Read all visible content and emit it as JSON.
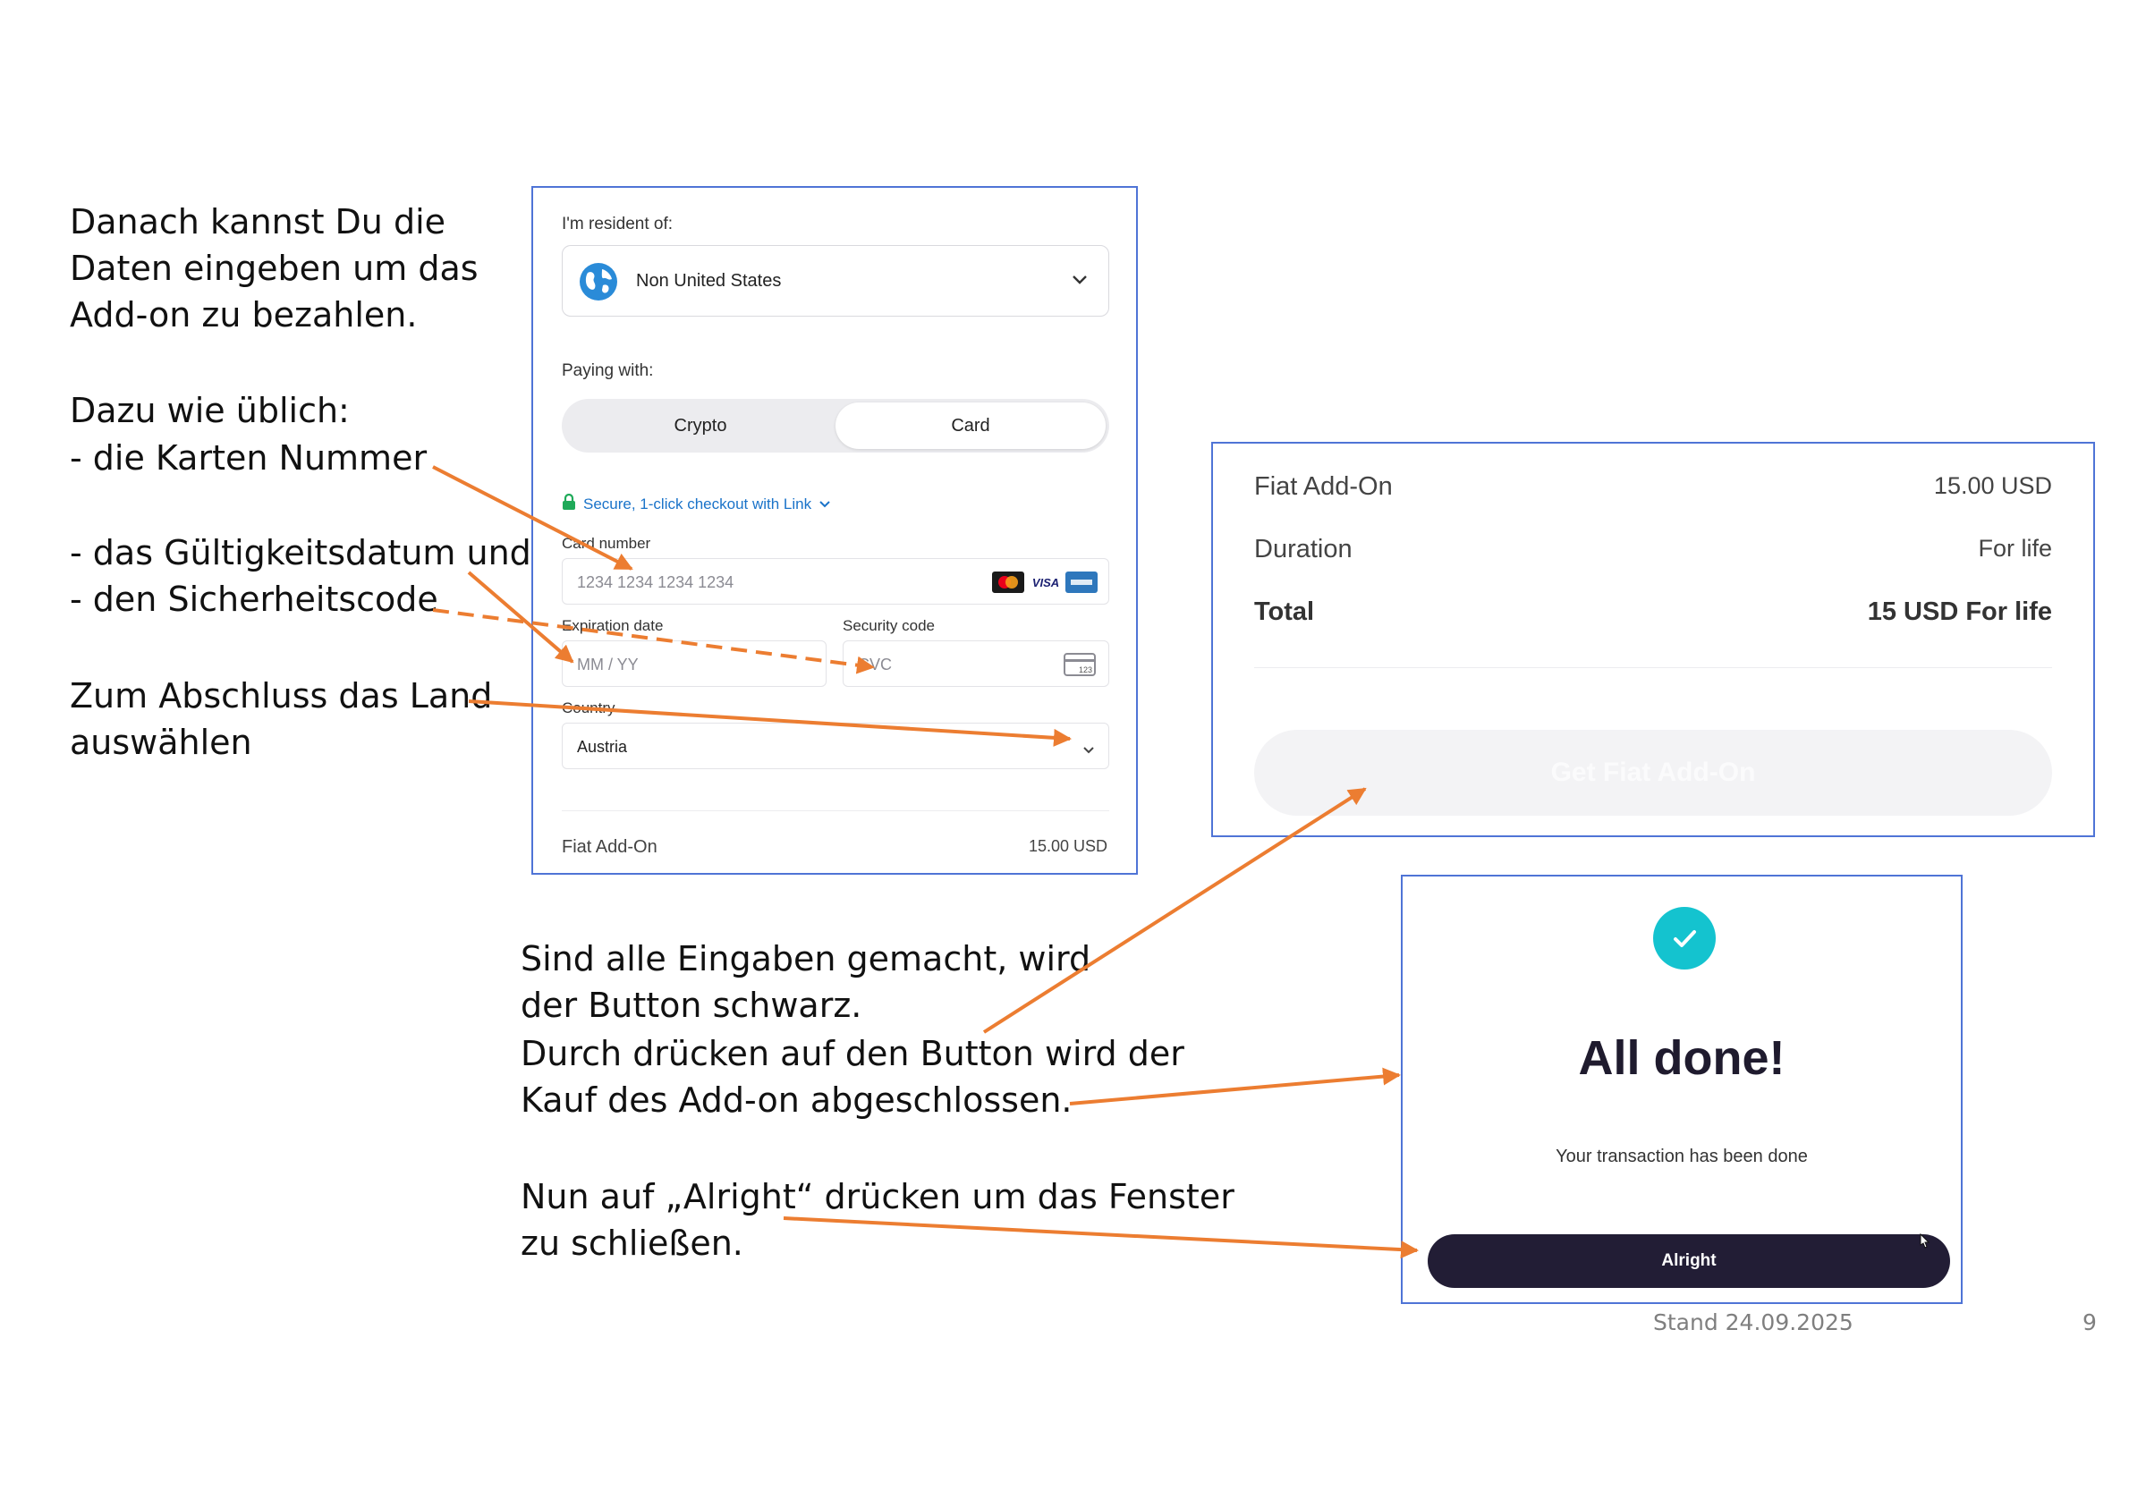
{
  "instructions": {
    "intro": [
      "Danach kannst Du die",
      "Daten eingeben um das",
      "Add-on zu bezahlen."
    ],
    "list_header": "Dazu wie üblich:",
    "card_number": "- die Karten Nummer",
    "expiry": "- das Gültigkeitsdatum und",
    "security": "- den Sicherheitscode",
    "country": [
      "Zum Abschluss das Land",
      "auswählen"
    ],
    "button_note": [
      "Sind alle Eingaben gemacht, wird",
      "der Button schwarz.",
      "Durch drücken auf den Button wird der",
      "Kauf des Add-on abgeschlossen."
    ],
    "alright_note": [
      "Nun auf „Alright“ drücken um das Fenster",
      "zu schließen."
    ]
  },
  "payment_form": {
    "resident_label": "I'm resident of:",
    "resident_value": "Non United States",
    "paying_label": "Paying with:",
    "tabs": [
      "Crypto",
      "Card"
    ],
    "active_tab": "Card",
    "link_text": "Secure, 1-click checkout with Link",
    "card_number_label": "Card number",
    "card_number_placeholder": "1234 1234 1234 1234",
    "card_brands": [
      "VISA"
    ],
    "expiration_label": "Expiration date",
    "expiration_placeholder": "MM / YY",
    "security_label": "Security code",
    "security_placeholder": "CVC",
    "cvc_icon_text": "123",
    "country_label": "Country",
    "country_value": "Austria",
    "summary_item": "Fiat Add-On",
    "summary_price": "15.00 USD"
  },
  "summary_panel": {
    "item_label": "Fiat Add-On",
    "item_value": "15.00 USD",
    "duration_label": "Duration",
    "duration_value": "For life",
    "total_label": "Total",
    "total_value": "15 USD For life",
    "button_label": "Get Fiat Add-On"
  },
  "done_dialog": {
    "title": "All done!",
    "message": "Your transaction has been done",
    "button_label": "Alright"
  },
  "footer": {
    "date": "Stand 24.09.2025",
    "page": "9"
  },
  "colors": {
    "arrow": "#ec7d31",
    "frame": "#4f74d6",
    "dark_button": "#221d35",
    "check": "#14c3cf",
    "link": "#1a73c9"
  }
}
